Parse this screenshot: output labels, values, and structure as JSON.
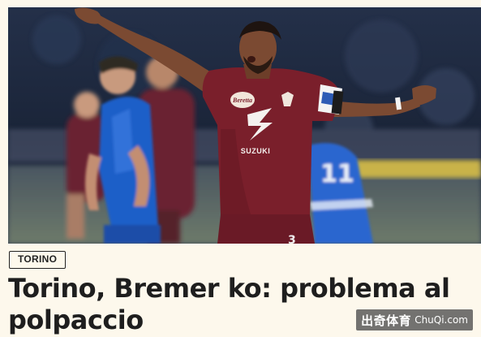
{
  "article": {
    "image_alt": "",
    "category": "TORINO",
    "headline": "Torino, Bremer ko: problema al polpaccio"
  },
  "player_shirt": {
    "sponsor_top": "Beretta",
    "sponsor_main": "SUZUKI",
    "number": "3",
    "opponent_number": "11"
  },
  "watermark": {
    "chinese": "出奇体育",
    "url": "ChuQi.com"
  },
  "colors": {
    "background": "#fdf8ec",
    "torino_maroon": "#7a1f2b",
    "empoli_blue": "#1f5fc8",
    "headline": "#1e1e1e"
  }
}
